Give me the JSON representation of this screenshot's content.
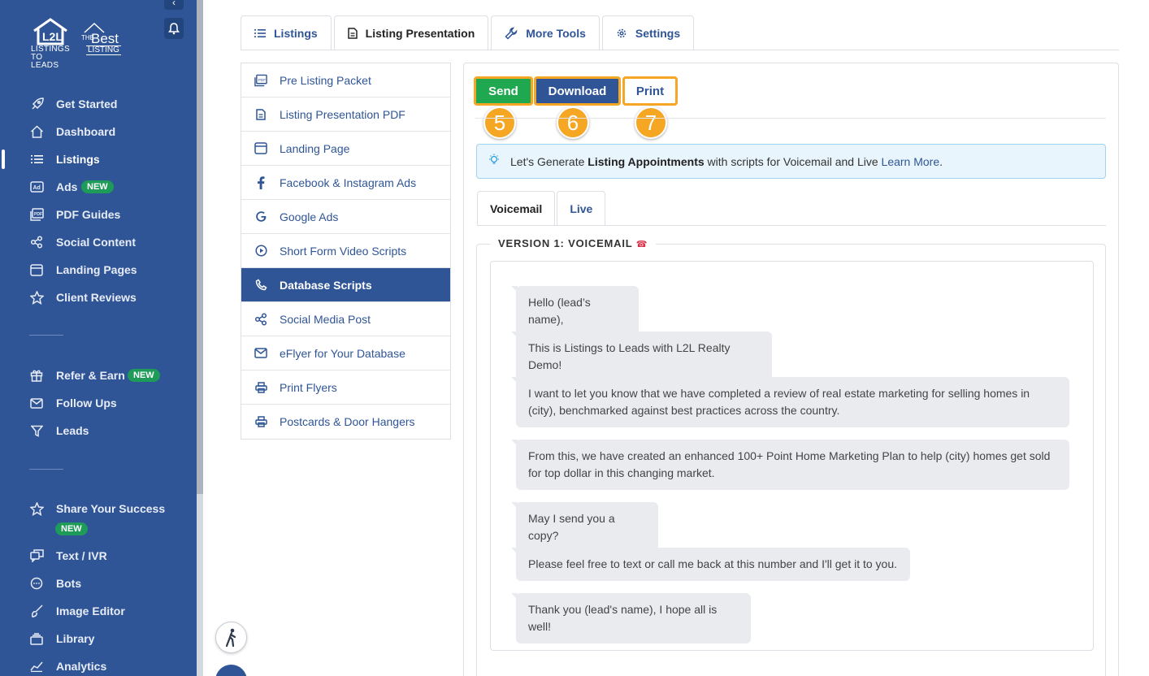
{
  "sidebar": {
    "logo": {
      "l2l_line1": "LISTINGS",
      "l2l_line2": "TO LEADS",
      "best_the": "THE",
      "best_main": "Best",
      "best_sub": "LISTING"
    },
    "nav": [
      {
        "label": "Get Started",
        "icon": "rocket-icon"
      },
      {
        "label": "Dashboard",
        "icon": "home-icon"
      },
      {
        "label": "Listings",
        "icon": "list-icon",
        "active": true
      },
      {
        "label": "Ads",
        "icon": "ad-icon",
        "badge": "NEW"
      },
      {
        "label": "PDF Guides",
        "icon": "pdf-icon"
      },
      {
        "label": "Social Content",
        "icon": "share-icon"
      },
      {
        "label": "Landing Pages",
        "icon": "window-icon"
      },
      {
        "label": "Client Reviews",
        "icon": "star-icon"
      },
      {
        "label": "Refer & Earn",
        "icon": "gift-icon",
        "badge": "NEW"
      },
      {
        "label": "Follow Ups",
        "icon": "mail-icon"
      },
      {
        "label": "Leads",
        "icon": "filter-icon"
      },
      {
        "label": "Share Your Success",
        "icon": "star-icon",
        "badge": "NEW"
      },
      {
        "label": "Text / IVR",
        "icon": "chat-icon"
      },
      {
        "label": "Bots",
        "icon": "bot-icon"
      },
      {
        "label": "Image Editor",
        "icon": "brush-icon"
      },
      {
        "label": "Library",
        "icon": "library-icon"
      },
      {
        "label": "Analytics",
        "icon": "chart-icon"
      }
    ]
  },
  "tabs": [
    {
      "label": "Listings",
      "icon": "list-icon"
    },
    {
      "label": "Listing Presentation",
      "icon": "document-icon",
      "active": true
    },
    {
      "label": "More Tools",
      "icon": "wrench-icon"
    },
    {
      "label": "Settings",
      "icon": "gear-icon"
    }
  ],
  "side_menu": [
    {
      "label": "Pre Listing Packet",
      "icon": "pdf-icon"
    },
    {
      "label": "Listing Presentation PDF",
      "icon": "document-icon"
    },
    {
      "label": "Landing Page",
      "icon": "window-icon"
    },
    {
      "label": "Facebook & Instagram Ads",
      "icon": "facebook-icon"
    },
    {
      "label": "Google Ads",
      "icon": "google-icon"
    },
    {
      "label": "Short Form Video Scripts",
      "icon": "play-icon"
    },
    {
      "label": "Database Scripts",
      "icon": "phone-icon",
      "active": true
    },
    {
      "label": "Social Media Post",
      "icon": "share-icon"
    },
    {
      "label": "eFlyer for Your Database",
      "icon": "mail-icon"
    },
    {
      "label": "Print Flyers",
      "icon": "printer-icon"
    },
    {
      "label": "Postcards & Door Hangers",
      "icon": "printer-icon"
    }
  ],
  "actions": {
    "send": "Send",
    "download": "Download",
    "print": "Print"
  },
  "steps": [
    "5",
    "6",
    "7"
  ],
  "info": {
    "prefix": "Let's Generate ",
    "bold": "Listing Appointments",
    "middle": " with scripts for Voicemail and Live ",
    "link": "Learn More",
    "suffix": "."
  },
  "subtabs": [
    {
      "label": "Voicemail",
      "active": true
    },
    {
      "label": "Live"
    }
  ],
  "version_title": "VERSION 1: VOICEMAIL",
  "voicemail_lines": [
    "Hello (lead’s name),",
    "This is Listings to Leads with L2L Realty Demo!",
    "I want to let you know that we have completed a review of real estate marketing for selling homes in (city), benchmarked against best practices across the country.",
    "From this, we have created an enhanced 100+ Point Home Marketing Plan to help (city) homes get sold for top dollar in this changing market.",
    "May I send you a copy?",
    "Please feel free to text or call me back at this number and I'll get it to you.",
    "Thank you (lead's name), I hope all is well!"
  ],
  "colors": {
    "sidebar": "#2f5597",
    "accent": "#2f5597",
    "send": "#1fa84f",
    "highlight": "#f5a623"
  }
}
